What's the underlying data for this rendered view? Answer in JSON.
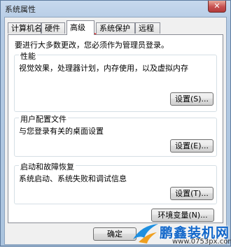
{
  "window": {
    "title": "系统属性",
    "close_label": "✕"
  },
  "tabs": [
    {
      "label": "计算机名"
    },
    {
      "label": "硬件"
    },
    {
      "label": "高级"
    },
    {
      "label": "系统保护"
    },
    {
      "label": "远程"
    }
  ],
  "panel": {
    "intro": "要进行大多数更改，您必须作为管理员登录。",
    "performance": {
      "title": "性能",
      "description": "视觉效果，处理器计划，内存使用，以及虚拟内存",
      "button": "设置(S)..."
    },
    "user_profiles": {
      "title": "用户配置文件",
      "description": "与您登录有关的桌面设置",
      "button": "设置(E)..."
    },
    "startup_recovery": {
      "title": "启动和故障恢复",
      "description": "系统启动、系统失败和调试信息",
      "button": "设置(T)..."
    },
    "env_button": "环境变量(N)..."
  },
  "footer": {
    "ok_button": "确定"
  },
  "watermark": {
    "brand": "鹏鑫装机网",
    "url": "www.0753px.com"
  },
  "colors": {
    "highlight": "#e02020",
    "watermark": "#1166c9"
  }
}
